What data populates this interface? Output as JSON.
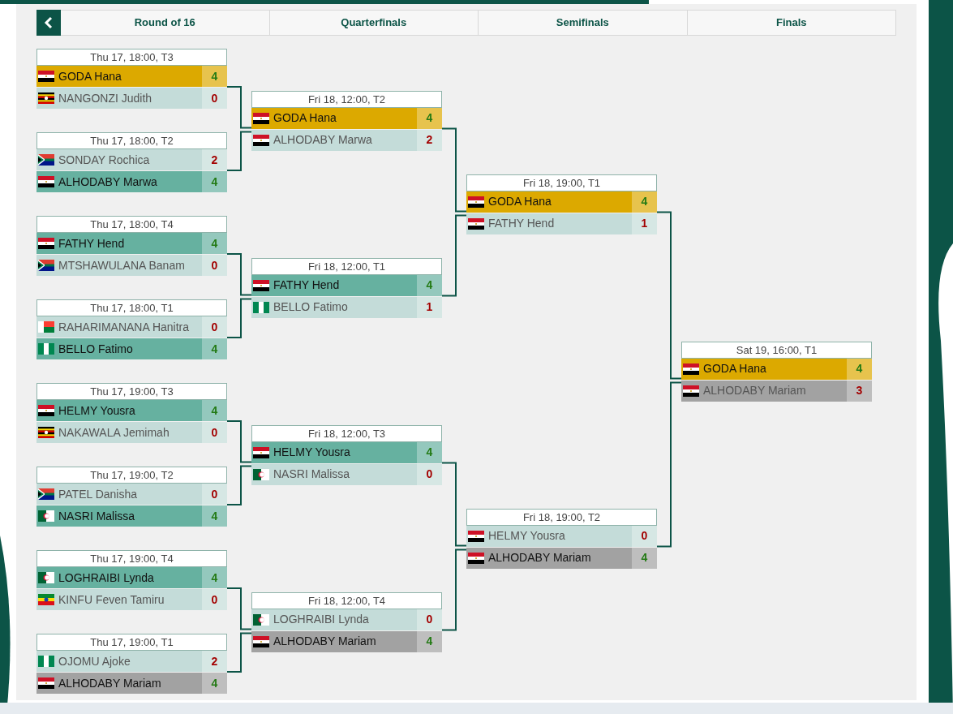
{
  "rounds": [
    {
      "label": "Round of 16",
      "matches": [
        {
          "time": "Thu 17, 18:00, T3",
          "players": [
            {
              "name": "GODA Hana",
              "kind": "egypt",
              "score": "4",
              "winner": true,
              "color": "#dca900"
            },
            {
              "name": "NANGONZI Judith",
              "kind": "uganda",
              "score": "0",
              "winner": false,
              "color": "#c4dcd9"
            }
          ]
        },
        {
          "time": "Thu 17, 18:00, T2",
          "players": [
            {
              "name": "SONDAY Rochica",
              "kind": "south-africa",
              "score": "2",
              "winner": false,
              "color": "#c4dcd9"
            },
            {
              "name": "ALHODABY Marwa",
              "kind": "egypt",
              "score": "4",
              "winner": true,
              "color": "#66b1a0"
            }
          ]
        },
        {
          "time": "Thu 17, 18:00, T4",
          "players": [
            {
              "name": "FATHY Hend",
              "kind": "egypt",
              "score": "4",
              "winner": true,
              "color": "#66b1a0"
            },
            {
              "name": "MTSHAWULANA Banam",
              "kind": "south-africa",
              "score": "0",
              "winner": false,
              "color": "#c4dcd9"
            }
          ]
        },
        {
          "time": "Thu 17, 18:00, T1",
          "players": [
            {
              "name": "RAHARIMANANA Hanitra",
              "kind": "madagascar",
              "score": "0",
              "winner": false,
              "color": "#c4dcd9"
            },
            {
              "name": "BELLO Fatimo",
              "kind": "nigeria",
              "score": "4",
              "winner": true,
              "color": "#66b1a0"
            }
          ]
        },
        {
          "time": "Thu 17, 19:00, T3",
          "players": [
            {
              "name": "HELMY Yousra",
              "kind": "egypt",
              "score": "4",
              "winner": true,
              "color": "#66b1a0"
            },
            {
              "name": "NAKAWALA Jemimah",
              "kind": "uganda",
              "score": "0",
              "winner": false,
              "color": "#c4dcd9"
            }
          ]
        },
        {
          "time": "Thu 17, 19:00, T2",
          "players": [
            {
              "name": "PATEL Danisha",
              "kind": "south-africa",
              "score": "0",
              "winner": false,
              "color": "#c4dcd9"
            },
            {
              "name": "NASRI Malissa",
              "kind": "algeria",
              "score": "4",
              "winner": true,
              "color": "#66b1a0"
            }
          ]
        },
        {
          "time": "Thu 17, 19:00, T4",
          "players": [
            {
              "name": "LOGHRAIBI Lynda",
              "kind": "algeria",
              "score": "4",
              "winner": true,
              "color": "#66b1a0"
            },
            {
              "name": "KINFU Feven Tamiru",
              "kind": "ethiopia",
              "score": "0",
              "winner": false,
              "color": "#c4dcd9"
            }
          ]
        },
        {
          "time": "Thu 17, 19:00, T1",
          "players": [
            {
              "name": "OJOMU Ajoke",
              "kind": "nigeria",
              "score": "2",
              "winner": false,
              "color": "#c4dcd9"
            },
            {
              "name": "ALHODABY Mariam",
              "kind": "egypt",
              "score": "4",
              "winner": true,
              "color": "#a2a2a2"
            }
          ]
        }
      ]
    },
    {
      "label": "Quarterfinals",
      "matches": [
        {
          "time": "Fri 18, 12:00, T2",
          "players": [
            {
              "name": "GODA Hana",
              "kind": "egypt",
              "score": "4",
              "winner": true,
              "color": "#dca900"
            },
            {
              "name": "ALHODABY Marwa",
              "kind": "egypt",
              "score": "2",
              "winner": false,
              "color": "#c4dcd9"
            }
          ]
        },
        {
          "time": "Fri 18, 12:00, T1",
          "players": [
            {
              "name": "FATHY Hend",
              "kind": "egypt",
              "score": "4",
              "winner": true,
              "color": "#66b1a0"
            },
            {
              "name": "BELLO Fatimo",
              "kind": "nigeria",
              "score": "1",
              "winner": false,
              "color": "#c4dcd9"
            }
          ]
        },
        {
          "time": "Fri 18, 12:00, T3",
          "players": [
            {
              "name": "HELMY Yousra",
              "kind": "egypt",
              "score": "4",
              "winner": true,
              "color": "#66b1a0"
            },
            {
              "name": "NASRI Malissa",
              "kind": "algeria",
              "score": "0",
              "winner": false,
              "color": "#c4dcd9"
            }
          ]
        },
        {
          "time": "Fri 18, 12:00, T4",
          "players": [
            {
              "name": "LOGHRAIBI Lynda",
              "kind": "algeria",
              "score": "0",
              "winner": false,
              "color": "#c4dcd9"
            },
            {
              "name": "ALHODABY Mariam",
              "kind": "egypt",
              "score": "4",
              "winner": true,
              "color": "#a2a2a2"
            }
          ]
        }
      ]
    },
    {
      "label": "Semifinals",
      "matches": [
        {
          "time": "Fri 18, 19:00, T1",
          "players": [
            {
              "name": "GODA Hana",
              "kind": "egypt",
              "score": "4",
              "winner": true,
              "color": "#dca900"
            },
            {
              "name": "FATHY Hend",
              "kind": "egypt",
              "score": "1",
              "winner": false,
              "color": "#c4dcd9"
            }
          ]
        },
        {
          "time": "Fri 18, 19:00, T2",
          "players": [
            {
              "name": "HELMY Yousra",
              "kind": "egypt",
              "score": "0",
              "winner": false,
              "color": "#c4dcd9"
            },
            {
              "name": "ALHODABY Mariam",
              "kind": "egypt",
              "score": "4",
              "winner": true,
              "color": "#a2a2a2"
            }
          ]
        }
      ]
    },
    {
      "label": "Finals",
      "matches": [
        {
          "time": "Sat 19, 16:00, T1",
          "players": [
            {
              "name": "GODA Hana",
              "kind": "egypt",
              "score": "4",
              "winner": true,
              "color": "#dca900"
            },
            {
              "name": "ALHODABY Mariam",
              "kind": "egypt",
              "score": "3",
              "winner": false,
              "color": "#a2a2a2"
            }
          ]
        }
      ]
    }
  ]
}
